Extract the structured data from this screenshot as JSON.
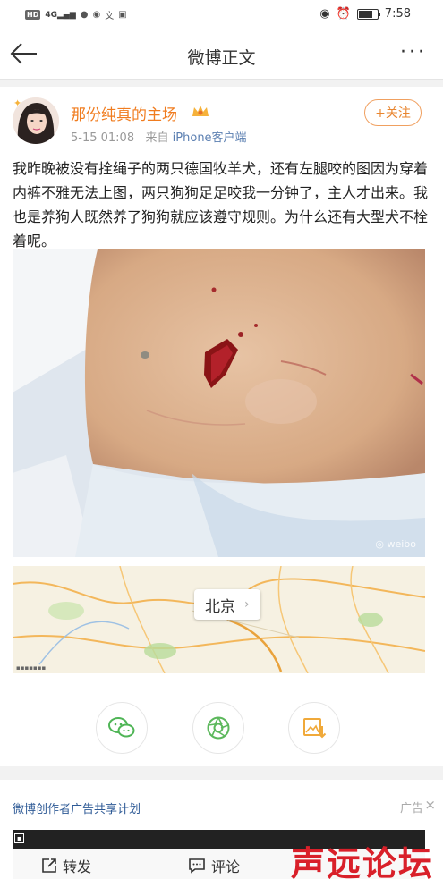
{
  "status_bar": {
    "left_chips": [
      "HD",
      "4G"
    ],
    "time": "7:58"
  },
  "nav": {
    "title": "微博正文",
    "back_icon": "back-arrow-icon",
    "more_icon": "more-dots-icon"
  },
  "post": {
    "username": "那份纯真的主场",
    "date": "5-15 01:08",
    "from_label": "来自",
    "source": "iPhone客户端",
    "follow_label": "+关注",
    "text": "我昨晚被没有拴绳子的两只德国牧羊犬，还有左腿咬的图因为穿着内裤不雅无法上图，两只狗狗足足咬我一分钟了，主人才出来。我也是养狗人既然养了狗狗就应该遵守规则。为什么还有大型犬不栓着呢。",
    "image_alt": "leg-bite-wound-photo",
    "location": "北京"
  },
  "share_buttons": [
    "wechat-icon",
    "moments-icon",
    "save-image-icon"
  ],
  "ad": {
    "title": "微博创作者广告共享计划",
    "tag": "广告"
  },
  "toolbar": {
    "repost_label": "转发",
    "comment_label": "评论"
  },
  "watermark_logo": "声远论坛",
  "colors": {
    "accent": "#f07c1f",
    "link": "#5b7fb1",
    "ad_title": "#2e5a96",
    "logo_red": "#d9202a"
  }
}
